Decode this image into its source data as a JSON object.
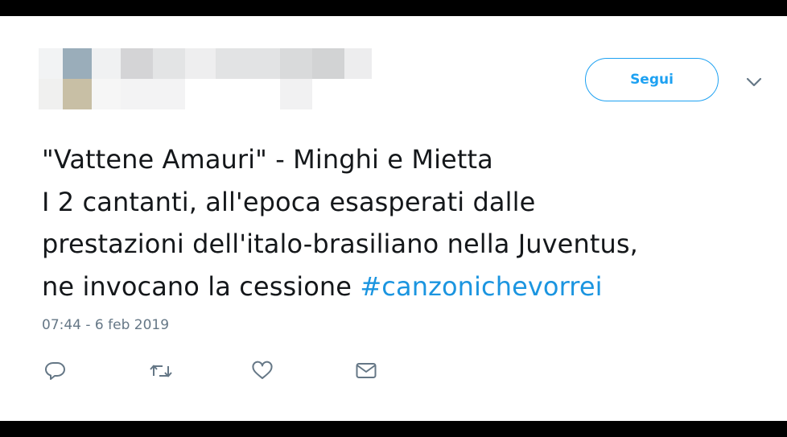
{
  "header": {
    "follow_label": "Segui",
    "menu_icon": "chevron-down-icon"
  },
  "tweet": {
    "lines": [
      "\"Vattene Amauri\" - Minghi e Mietta",
      "I 2 cantanti, all'epoca esasperati dalle",
      "prestazioni dell'italo-brasiliano nella Juventus,",
      "ne invocano la cessione "
    ],
    "hashtag": "#canzonichevorrei",
    "timestamp": "07:44 - 6 feb 2019"
  },
  "actions": [
    {
      "name": "reply",
      "icon": "speech-bubble-icon"
    },
    {
      "name": "retweet",
      "icon": "retweet-icon"
    },
    {
      "name": "like",
      "icon": "heart-icon"
    },
    {
      "name": "direct-message",
      "icon": "envelope-icon"
    }
  ],
  "colors": {
    "accent": "#1da1f2",
    "hashtag": "#1b95e0",
    "text": "#14171a",
    "muted": "#657786",
    "icon": "#657786",
    "frame": "#000000"
  }
}
